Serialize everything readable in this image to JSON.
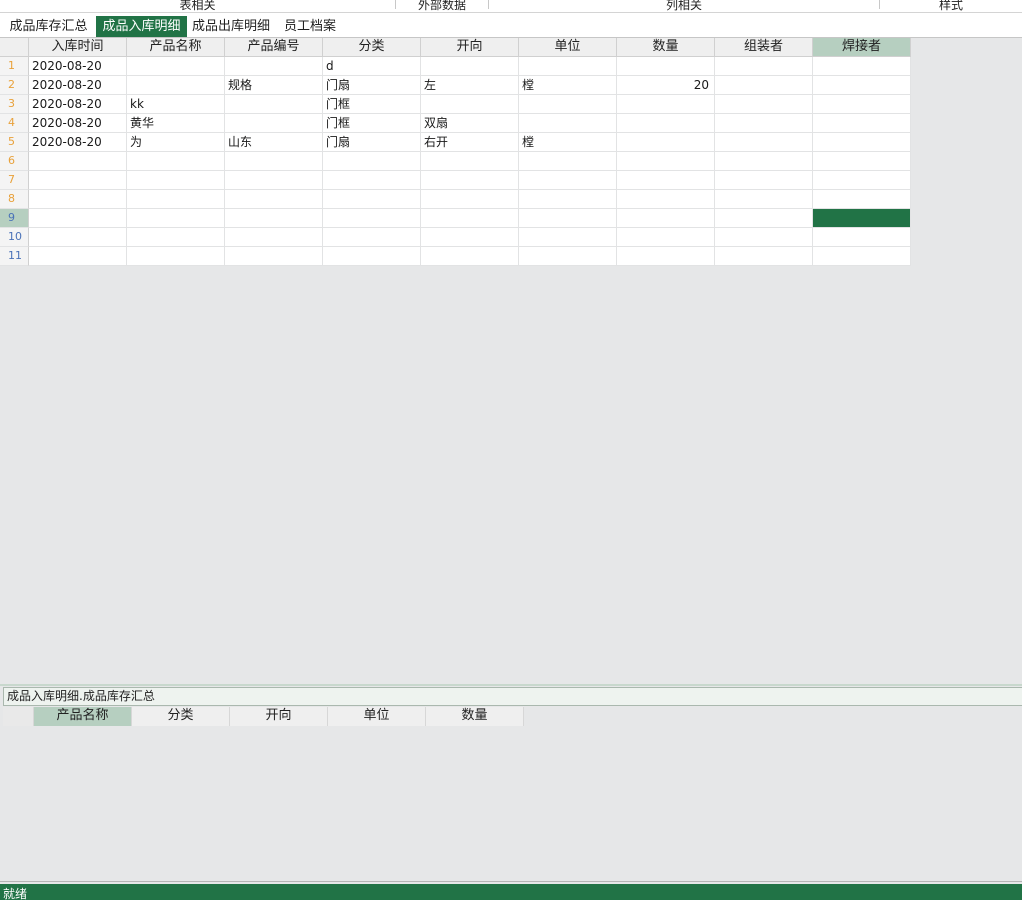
{
  "ribbon": {
    "groups": [
      "表相关",
      "外部数据",
      "列相关",
      "样式"
    ]
  },
  "sheet_tabs": [
    {
      "label": "成品库存汇总",
      "active": false
    },
    {
      "label": "成品入库明细",
      "active": true
    },
    {
      "label": "成品出库明细",
      "active": false
    },
    {
      "label": "员工档案",
      "active": false
    }
  ],
  "grid": {
    "columns": [
      "入库时间",
      "产品名称",
      "产品编号",
      "分类",
      "开向",
      "单位",
      "数量",
      "组装者",
      "焊接者"
    ],
    "selected_column": "焊接者",
    "selected_row": "9",
    "rows": [
      {
        "num": "1",
        "cells": [
          "2020-08-20",
          "",
          "",
          "d",
          "",
          "",
          "",
          "",
          ""
        ]
      },
      {
        "num": "2",
        "cells": [
          "2020-08-20",
          "",
          "规格",
          "门扇",
          "左",
          "樘",
          "20",
          "",
          ""
        ]
      },
      {
        "num": "3",
        "cells": [
          "2020-08-20",
          "kk",
          "",
          "门框",
          "",
          "",
          "",
          "",
          ""
        ]
      },
      {
        "num": "4",
        "cells": [
          "2020-08-20",
          "黄华",
          "",
          "门框",
          "双扇",
          "",
          "",
          "",
          ""
        ]
      },
      {
        "num": "5",
        "cells": [
          "2020-08-20",
          "为",
          "山东",
          "门扇",
          "右开",
          "樘",
          "",
          "",
          ""
        ]
      },
      {
        "num": "6",
        "cells": [
          "",
          "",
          "",
          "",
          "",
          "",
          "",
          "",
          ""
        ]
      },
      {
        "num": "7",
        "cells": [
          "",
          "",
          "",
          "",
          "",
          "",
          "",
          "",
          ""
        ]
      },
      {
        "num": "8",
        "cells": [
          "",
          "",
          "",
          "",
          "",
          "",
          "",
          "",
          ""
        ]
      },
      {
        "num": "9",
        "cells": [
          "",
          "",
          "",
          "",
          "",
          "",
          "",
          "",
          ""
        ]
      },
      {
        "num": "10",
        "cells": [
          "",
          "",
          "",
          "",
          "",
          "",
          "",
          "",
          ""
        ]
      },
      {
        "num": "11",
        "cells": [
          "",
          "",
          "",
          "",
          "",
          "",
          "",
          "",
          ""
        ]
      }
    ]
  },
  "formula_bar": {
    "text": "成品入库明细.成品库存汇总"
  },
  "sub_grid": {
    "columns": [
      "产品名称",
      "分类",
      "开向",
      "单位",
      "数量"
    ],
    "selected_column": "产品名称"
  },
  "status_bar": {
    "text": "就绪"
  },
  "colors": {
    "accent": "#217346",
    "header_selected": "#b6cfc0",
    "row_number": "#e8a13a",
    "row_number_blue": "#4a72b8"
  }
}
